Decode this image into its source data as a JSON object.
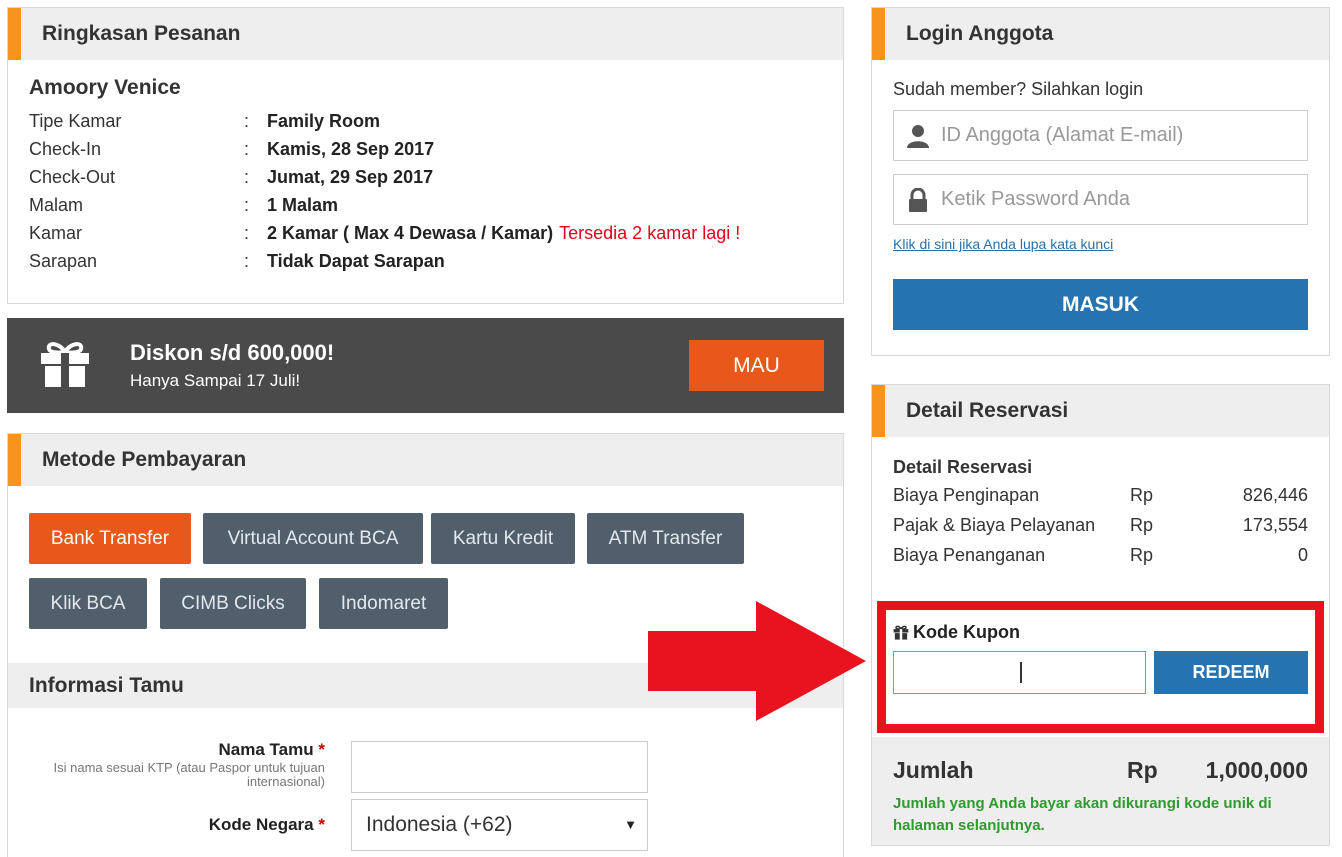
{
  "summary": {
    "title": "Ringkasan Pesanan",
    "hotel_name": "Amoory Venice",
    "rows": [
      {
        "label": "Tipe Kamar",
        "value": "Family Room"
      },
      {
        "label": "Check-In",
        "value": "Kamis, 28 Sep 2017"
      },
      {
        "label": "Check-Out",
        "value": "Jumat, 29 Sep 2017"
      },
      {
        "label": "Malam",
        "value": "1 Malam"
      },
      {
        "label": "Kamar",
        "value": "2 Kamar ( Max 4 Dewasa / Kamar)",
        "warning": "Tersedia 2 kamar lagi !"
      },
      {
        "label": "Sarapan",
        "value": "Tidak Dapat Sarapan"
      }
    ],
    "colon": ":"
  },
  "promo": {
    "title": "Diskon s/d 600,000!",
    "subtitle": "Hanya Sampai 17 Juli!",
    "button": "MAU",
    "icon": "gift-icon"
  },
  "payment": {
    "title": "Metode Pembayaran",
    "methods": [
      "Bank Transfer",
      "Virtual Account BCA",
      "Kartu Kredit",
      "ATM Transfer",
      "Klik BCA",
      "CIMB Clicks",
      "Indomaret"
    ],
    "selected": "Bank Transfer"
  },
  "guest": {
    "title": "Informasi Tamu",
    "name_label": "Nama Tamu",
    "required_mark": "*",
    "name_hint": "Isi nama sesuai KTP (atau Paspor untuk tujuan internasional)",
    "name_value": "",
    "country_label": "Kode Negara",
    "country_value": "Indonesia (+62)"
  },
  "login": {
    "title": "Login Anggota",
    "intro": "Sudah member? Silahkan login",
    "id_placeholder": "ID Anggota (Alamat E-mail)",
    "password_placeholder": "Ketik Password Anda",
    "forgot_link": "Klik di sini jika Anda lupa kata kunci",
    "submit": "MASUK"
  },
  "reservation": {
    "title": "Detail Reservasi",
    "subtitle": "Detail Reservasi",
    "currency": "Rp",
    "rows": [
      {
        "label": "Biaya Penginapan",
        "value": "826,446"
      },
      {
        "label": "Pajak & Biaya Pelayanan",
        "value": "173,554"
      },
      {
        "label": "Biaya Penanganan",
        "value": "0"
      }
    ],
    "coupon_label": "Kode Kupon",
    "coupon_value": "",
    "redeem": "REDEEM",
    "total_label": "Jumlah",
    "total_value": "1,000,000",
    "total_note": "Jumlah yang Anda bayar akan dikurangi kode unik di halaman selanjutnya."
  },
  "colors": {
    "accent_orange": "#f7941d",
    "button_orange": "#e9581b",
    "button_blue": "#2573b0",
    "method_gray": "#515e6b",
    "warning_red": "#e2001a",
    "note_green": "#2e9b2e",
    "annotation_red": "#e8131f"
  }
}
